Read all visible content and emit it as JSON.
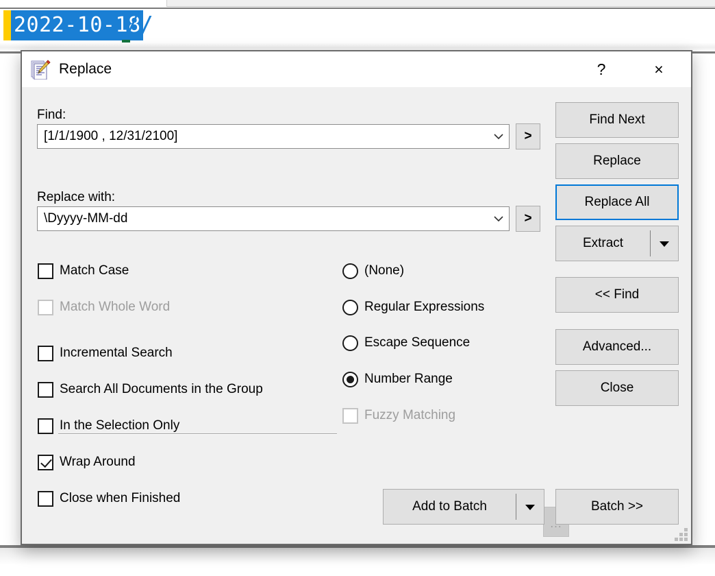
{
  "editor": {
    "line_text": "2022-10-18",
    "caret_mark": "//",
    "selection_color": "#1a7fd4",
    "margin_color": "#ffcc00",
    "eof_marker_color": "#14733f"
  },
  "dialog": {
    "title": "Replace",
    "icon": "notepad-pencil-icon",
    "help_label": "?",
    "close_label": "×",
    "accent_color": "#0078d7"
  },
  "find": {
    "label": "Find:",
    "value": "[1/1/1900 , 12/31/2100]",
    "placeholder": "",
    "expand_label": ">"
  },
  "replace": {
    "label": "Replace with:",
    "value": "\\Dyyyy-MM-dd",
    "placeholder": "",
    "expand_label": ">"
  },
  "options": {
    "checkboxes": [
      {
        "label": "Match Case",
        "checked": false,
        "disabled": false
      },
      {
        "label": "Match Whole Word",
        "checked": false,
        "disabled": true
      },
      {
        "label": "Incremental Search",
        "checked": false,
        "disabled": false
      },
      {
        "label": "Search All Documents in the Group",
        "checked": false,
        "disabled": false
      },
      {
        "label": "In the Selection Only",
        "checked": false,
        "disabled": false
      },
      {
        "label": "Wrap Around",
        "checked": true,
        "disabled": false
      },
      {
        "label": "Close when Finished",
        "checked": false,
        "disabled": false
      }
    ],
    "radios": [
      {
        "label": "(None)",
        "selected": false
      },
      {
        "label": "Regular Expressions",
        "selected": false
      },
      {
        "label": "Escape Sequence",
        "selected": false
      },
      {
        "label": "Number Range",
        "selected": true
      }
    ],
    "fuzzy": {
      "label": "Fuzzy Matching",
      "checked": false,
      "disabled": true
    },
    "fuzzy_ellipsis_label": "..."
  },
  "buttons": {
    "find_next": "Find Next",
    "replace": "Replace",
    "replace_all": "Replace All",
    "extract": "Extract",
    "find_toggle": "<< Find",
    "advanced": "Advanced...",
    "close": "Close",
    "add_to_batch": "Add to Batch",
    "batch": "Batch >>"
  }
}
